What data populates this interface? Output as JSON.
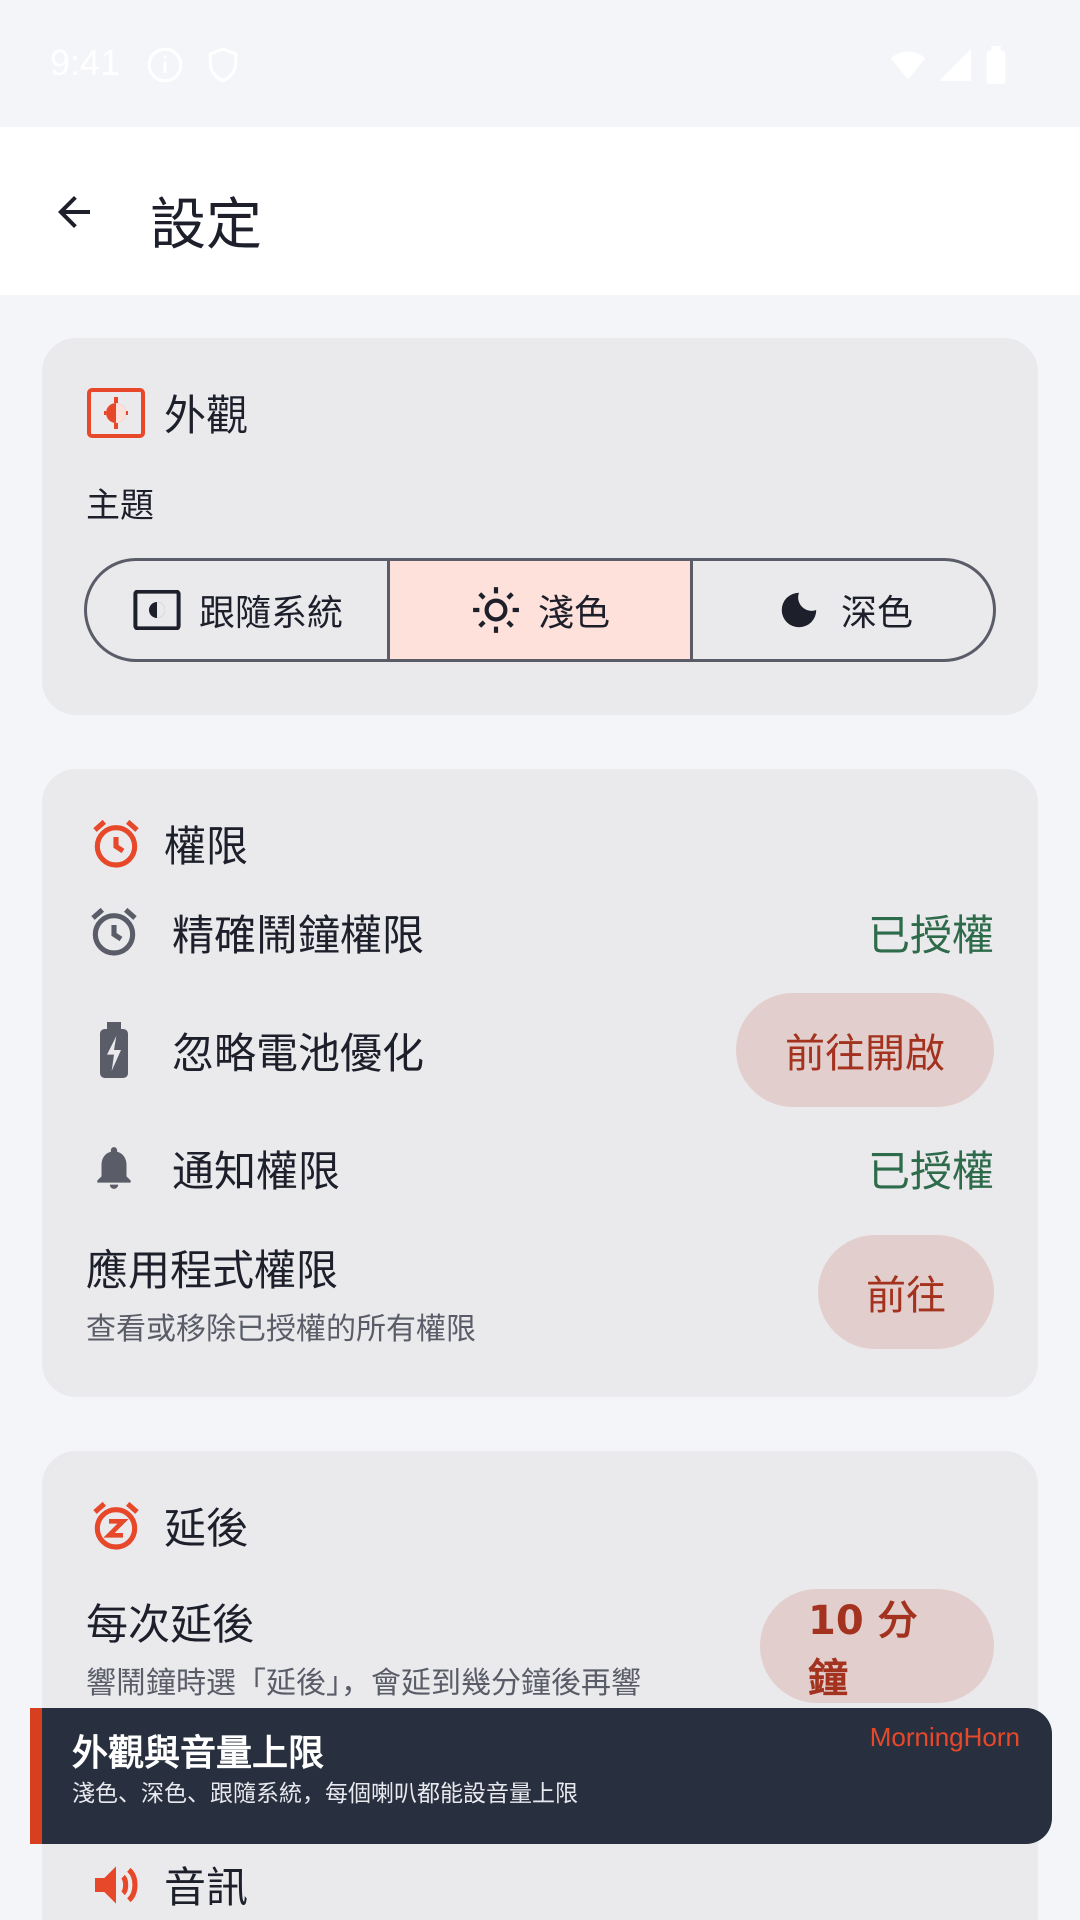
{
  "status_bar": {
    "time": "9:41"
  },
  "header": {
    "title": "設定"
  },
  "appearance": {
    "title": "外觀",
    "theme_label": "主題",
    "options": [
      {
        "label": "跟隨系統",
        "icon": "brightness-auto-icon",
        "selected": false
      },
      {
        "label": "淺色",
        "icon": "sun-icon",
        "selected": true
      },
      {
        "label": "深色",
        "icon": "moon-icon",
        "selected": false
      }
    ]
  },
  "permissions": {
    "title": "權限",
    "exact_alarm": {
      "label": "精確鬧鐘權限",
      "status": "已授權"
    },
    "battery": {
      "label": "忽略電池優化",
      "action": "前往開啟"
    },
    "notification": {
      "label": "通知權限",
      "status": "已授權"
    },
    "app_permissions": {
      "label": "應用程式權限",
      "description": "查看或移除已授權的所有權限",
      "action": "前往"
    }
  },
  "snooze": {
    "title": "延後",
    "each_snooze": {
      "label": "每次延後",
      "description": "響鬧鐘時選「延後」，會延到幾分鐘後再響",
      "value": "10 分鐘"
    }
  },
  "toast": {
    "title": "外觀與音量上限",
    "subtitle": "淺色、深色、跟隨系統，每個喇叭都能設音量上限",
    "brand": "MorningHorn"
  },
  "audio": {
    "title": "音訊"
  },
  "colors": {
    "accent": "#e8482a",
    "granted": "#2e6b4a",
    "pill_bg": "#e2cfcd",
    "selected_bg": "#fde1da"
  }
}
